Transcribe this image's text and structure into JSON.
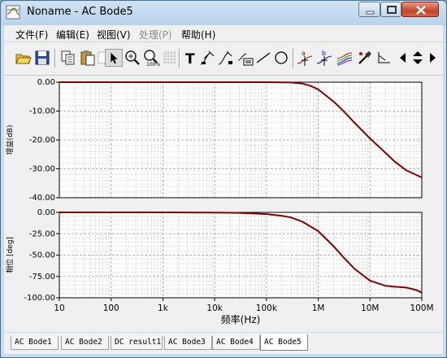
{
  "window": {
    "title": "Noname - AC Bode5"
  },
  "menu": [
    {
      "label": "文件(F)",
      "enabled": true
    },
    {
      "label": "编辑(E)",
      "enabled": true
    },
    {
      "label": "视图(V)",
      "enabled": true
    },
    {
      "label": "处理(P)",
      "enabled": false
    },
    {
      "label": "帮助(H)",
      "enabled": true
    }
  ],
  "toolbar": {
    "icons": [
      "open-folder-icon",
      "save-icon",
      "copy-icon",
      "paste-icon",
      "grid-icon",
      "pointer-icon",
      "zoom-in-icon",
      "zoom-100-icon",
      "grid-toggle-icon",
      "text-tool-icon",
      "cursor-left-icon",
      "cursor-right-icon",
      "note-icon",
      "line-tool-icon",
      "circle-tool-icon",
      "cursor-a-icon",
      "cursor-b-icon",
      "curve-colors-icon",
      "probe-icon",
      "step-icon",
      "previous-icon",
      "up-down-icon",
      "next-icon"
    ],
    "pressed": "pointer-icon"
  },
  "tabs": [
    "AC Bode1",
    "AC Bode2",
    "DC result1",
    "AC Bode3",
    "AC Bode4",
    "AC Bode5"
  ],
  "active_tab": "AC Bode5",
  "chart_data": [
    {
      "type": "line",
      "ylabel": "增益(dB)",
      "xscale": "log",
      "xlim": [
        10,
        100000000
      ],
      "ylim": [
        -40,
        0
      ],
      "yticks": [
        "0.00",
        "-10.00",
        "-20.00",
        "-30.00",
        "-40.00"
      ],
      "grid": true,
      "series": [
        {
          "color": "#800000",
          "x": [
            10,
            100,
            1000,
            10000,
            100000,
            300000,
            500000,
            700000,
            1000000,
            2000000,
            3000000,
            5000000,
            10000000,
            20000000,
            30000000,
            50000000,
            100000000
          ],
          "values": [
            0,
            0,
            0,
            0,
            0,
            -0.1,
            -0.5,
            -1.2,
            -2.5,
            -6.8,
            -9.8,
            -14,
            -19.5,
            -24.5,
            -27.5,
            -30.5,
            -33
          ]
        }
      ]
    },
    {
      "type": "line",
      "xlabel": "频率(Hz)",
      "ylabel": "相位 [deg]",
      "xscale": "log",
      "xlim": [
        10,
        100000000
      ],
      "ylim": [
        -100,
        0
      ],
      "xticks": [
        "10",
        "100",
        "1k",
        "10k",
        "100k",
        "1M",
        "10M",
        "100M"
      ],
      "yticks": [
        "0.00",
        "-25.00",
        "-50.00",
        "-75.00",
        "-100.00"
      ],
      "grid": true,
      "series": [
        {
          "color": "#800000",
          "x": [
            10,
            100,
            1000,
            10000,
            30000,
            100000,
            200000,
            300000,
            500000,
            1000000,
            2000000,
            3000000,
            5000000,
            10000000,
            20000000,
            30000000,
            50000000,
            80000000,
            100000000
          ],
          "values": [
            0,
            0,
            0,
            -0.3,
            -0.6,
            -2,
            -4,
            -6,
            -11,
            -22,
            -40,
            -52,
            -66,
            -80,
            -86,
            -87,
            -88,
            -91,
            -94
          ]
        }
      ]
    }
  ]
}
